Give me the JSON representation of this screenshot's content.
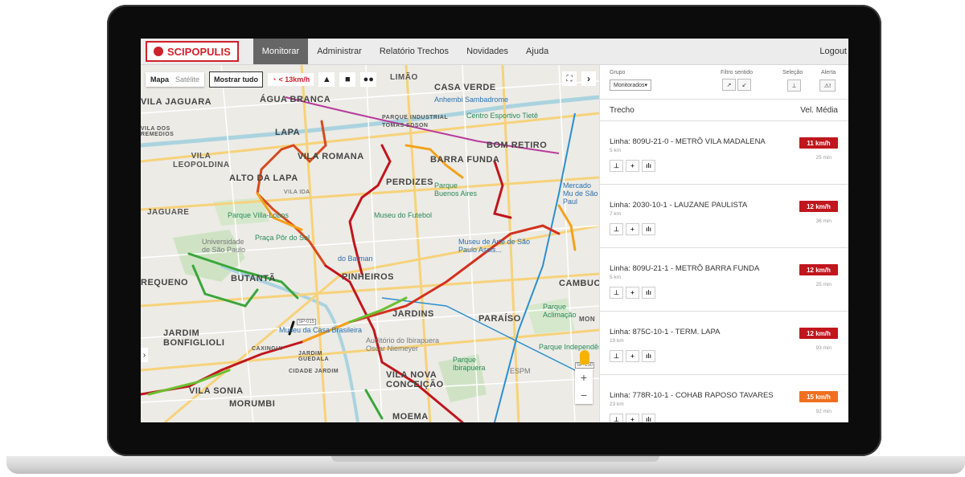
{
  "app": {
    "logo_text": "SCIPOPULIS",
    "nav": [
      {
        "label": "Monitorar",
        "active": true
      },
      {
        "label": "Administrar"
      },
      {
        "label": "Relatório Trechos"
      },
      {
        "label": "Novidades"
      },
      {
        "label": "Ajuda"
      }
    ],
    "logout": "Logout"
  },
  "map": {
    "type_selected": "Mapa",
    "type_other": "Satélite",
    "show_all": "Mostrar tudo",
    "speed_filter": "< 13km/h",
    "neighborhoods": [
      "LIMÃO",
      "CASA VERDE",
      "VILA JAGUARA",
      "ÁGUA BRANCA",
      "PARQUE INDUSTRIAL",
      "TOMAS EDSON",
      "LAPA",
      "VILA DOS REMEDIOS",
      "BOM RETIRO",
      "VILA ROMANA",
      "VILA LEOPOLDINA",
      "BARRA FUNDA",
      "ALTO DA LAPA",
      "PERDIZES",
      "VILA IDA",
      "JAGUARE",
      "PINHEIROS",
      "CAMBUCI",
      "JARDINS",
      "PARAÍSO",
      "JARDIM BONFIGLIOLI",
      "CAXINGUI",
      "JARDIM GUEDALA",
      "CIDADE JARDIM",
      "VILA NOVA CONCEIÇÃO",
      "VILA SONIA",
      "MORUMBI",
      "MOEMA",
      "BUTANTÃ",
      "REQUENO",
      "MON"
    ],
    "pois": [
      "Anhembi Sambadrome",
      "Centro Esportivo Tietê",
      "Parque Villa-Lobos",
      "Praça Pôr do Sol",
      "Parque Buenos Aires",
      "Museu do Futebol",
      "Museu de Arte de São Paulo Assis...",
      "Mercado Mu de São Paul",
      "do Batman",
      "Universidade de São Paulo",
      "Museu da Casa Brasileira",
      "Auditório do Ibirapuera Oscar Niemeyer",
      "Parque Ibirapuera",
      "Parque Aclimação",
      "Parque Independência",
      "ESPM",
      "SP-015",
      "SP-150"
    ],
    "chart_data": null
  },
  "panel": {
    "group_label": "Grupo",
    "group_value": "Monitorados",
    "filter_label": "Filtro sentido",
    "selection_label": "Seleção",
    "alert_label": "Alerta",
    "col_route": "Trecho",
    "col_speed": "Vel. Média",
    "routes": [
      {
        "name": "Linha: 809U-21-0 - METRÔ VILA MADALENA",
        "dist": "5 km",
        "speed": "11 km/h",
        "time": "25 min",
        "color": "#c0161d"
      },
      {
        "name": "Linha: 2030-10-1 - LAUZANE PAULISTA",
        "dist": "7 km",
        "speed": "12 km/h",
        "time": "36 min",
        "color": "#c0161d"
      },
      {
        "name": "Linha: 809U-21-1 - METRÔ BARRA FUNDA",
        "dist": "5 km",
        "speed": "12 km/h",
        "time": "25 min",
        "color": "#c0161d"
      },
      {
        "name": "Linha: 875C-10-1 - TERM. LAPA",
        "dist": "19 km",
        "speed": "12 km/h",
        "time": "93 min",
        "color": "#c0161d"
      },
      {
        "name": "Linha: 778R-10-1 - COHAB RAPOSO TAVARES",
        "dist": "23 km",
        "speed": "15 km/h",
        "time": "92 min",
        "color": "#f07020"
      }
    ]
  }
}
